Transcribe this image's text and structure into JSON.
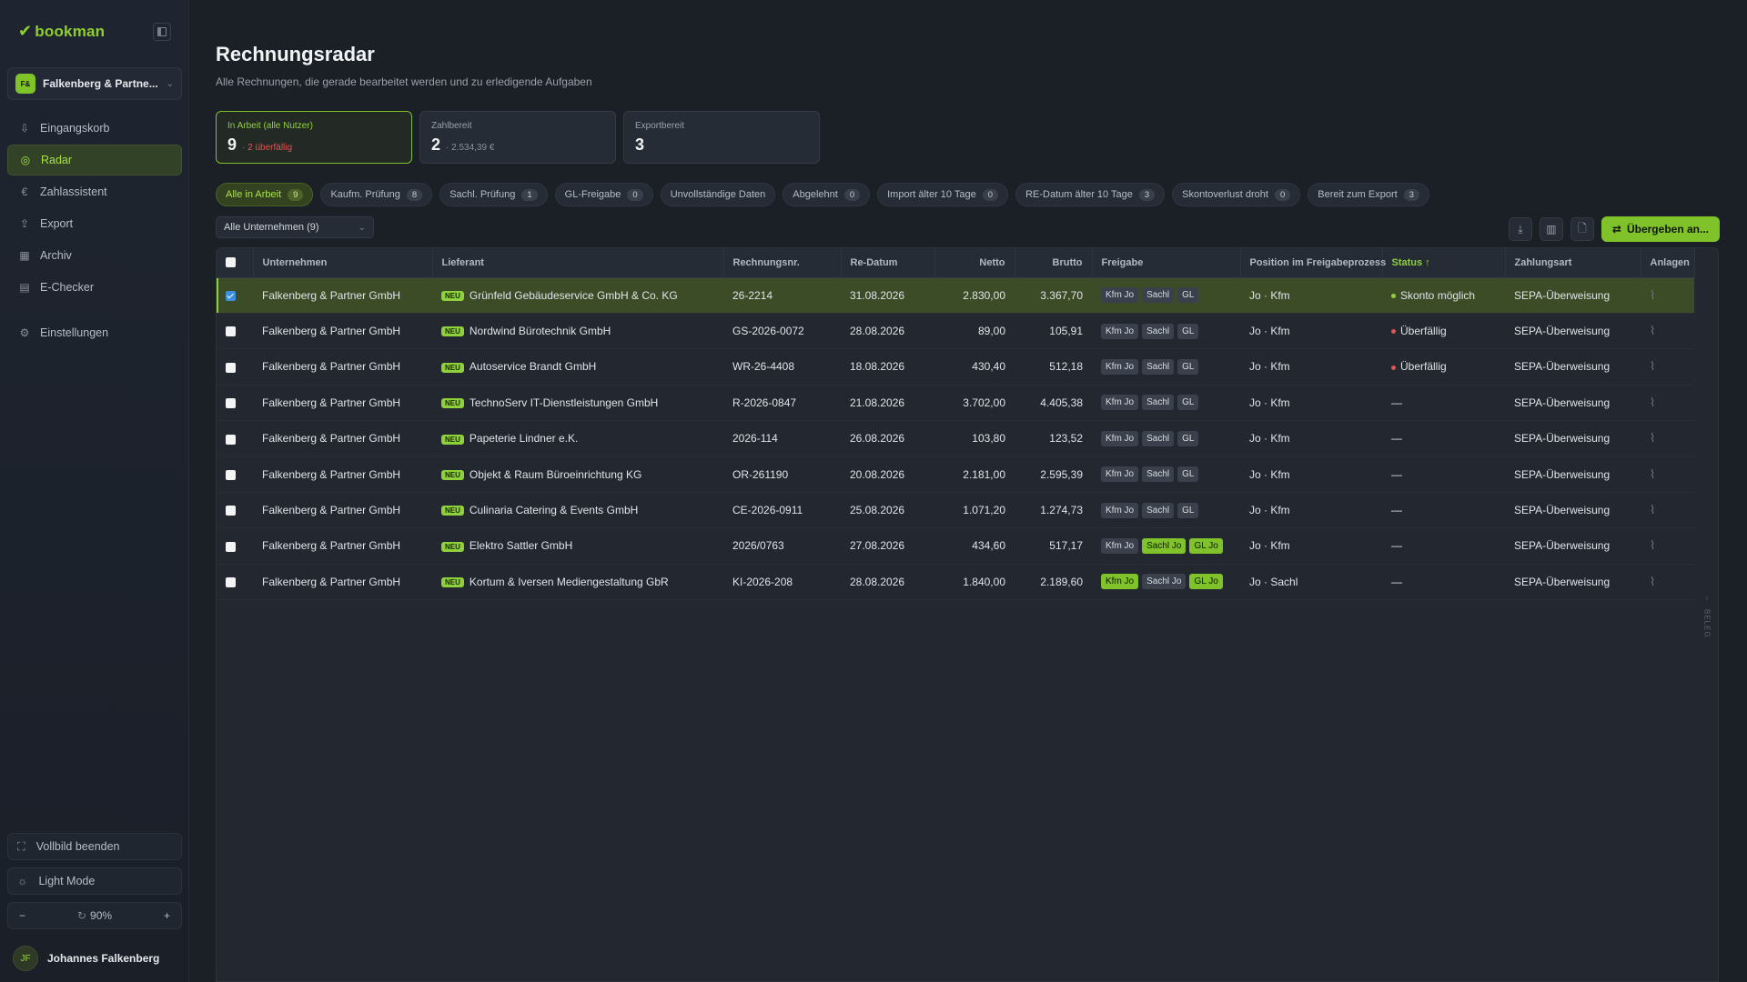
{
  "brand": {
    "name": "bookman"
  },
  "company": {
    "badge": "F&",
    "name": "Falkenberg & Partne..."
  },
  "nav": [
    {
      "label": "Eingangskorb",
      "icon": "inbox-icon",
      "glyph": "⇩"
    },
    {
      "label": "Radar",
      "icon": "radar-icon",
      "glyph": "◎"
    },
    {
      "label": "Zahlassistent",
      "icon": "euro-icon",
      "glyph": "€"
    },
    {
      "label": "Export",
      "icon": "export-icon",
      "glyph": "⇪"
    },
    {
      "label": "Archiv",
      "icon": "archive-icon",
      "glyph": "▦"
    },
    {
      "label": "E-Checker",
      "icon": "document-check-icon",
      "glyph": "▤"
    },
    {
      "label": "Einstellungen",
      "icon": "gear-icon",
      "glyph": "⚙"
    }
  ],
  "sidebar_bottom": {
    "fullscreen": "Vollbild beenden",
    "light_mode": "Light Mode",
    "zoom": "90%",
    "zoom_minus": "−",
    "zoom_plus": "+"
  },
  "user": {
    "initials": "JF",
    "name": "Johannes Falkenberg"
  },
  "page": {
    "title": "Rechnungsradar",
    "subtitle": "Alle Rechnungen, die gerade bearbeitet werden und zu erledigende Aufgaben"
  },
  "cards": [
    {
      "label": "In Arbeit (alle Nutzer)",
      "value": "9",
      "sub": "· 2 überfällig"
    },
    {
      "label": "Zahlbereit",
      "value": "2",
      "sub": "· 2.534,39 €"
    },
    {
      "label": "Exportbereit",
      "value": "3",
      "sub": ""
    }
  ],
  "filters": [
    {
      "label": "Alle in Arbeit",
      "count": "9"
    },
    {
      "label": "Kaufm. Prüfung",
      "count": "8"
    },
    {
      "label": "Sachl. Prüfung",
      "count": "1"
    },
    {
      "label": "GL-Freigabe",
      "count": "0"
    },
    {
      "label": "Unvollständige Daten",
      "count": ""
    },
    {
      "label": "Abgelehnt",
      "count": "0"
    },
    {
      "label": "Import älter 10 Tage",
      "count": "0"
    },
    {
      "label": "RE-Datum älter 10 Tage",
      "count": "3"
    },
    {
      "label": "Skontoverlust droht",
      "count": "0"
    },
    {
      "label": "Bereit zum Export",
      "count": "3"
    }
  ],
  "company_filter": "Alle Unternehmen (9)",
  "handover_button": "Übergeben an...",
  "columns": [
    "Unternehmen",
    "Lieferant",
    "Rechnungsnr.",
    "Re-Datum",
    "Netto",
    "Brutto",
    "Freigabe",
    "Position im Freigabeprozess",
    "Status ↑",
    "Zahlungsart",
    "Anlagen"
  ],
  "new_badge": "NEU",
  "side_panel_label": "BELEG",
  "rows": [
    {
      "company": "Falkenberg & Partner GmbH",
      "supplier": "Grünfeld Gebäudeservice GmbH & Co. KG",
      "number": "26-2214",
      "date": "31.08.2026",
      "net": "2.830,00",
      "gross": "3.367,70",
      "approvals": [
        "Kfm Jo",
        "Sachl",
        "GL"
      ],
      "approvals_done": [
        false,
        false,
        false
      ],
      "position": "Jo · Kfm",
      "status": "Skonto möglich",
      "status_color": "green",
      "payment": "SEPA-Überweisung",
      "selected": true
    },
    {
      "company": "Falkenberg & Partner GmbH",
      "supplier": "Nordwind Bürotechnik GmbH",
      "number": "GS-2026-0072",
      "date": "28.08.2026",
      "net": "89,00",
      "gross": "105,91",
      "approvals": [
        "Kfm Jo",
        "Sachl",
        "GL"
      ],
      "approvals_done": [
        false,
        false,
        false
      ],
      "position": "Jo · Kfm",
      "status": "Überfällig",
      "status_color": "red",
      "payment": "SEPA-Überweisung",
      "selected": false
    },
    {
      "company": "Falkenberg & Partner GmbH",
      "supplier": "Autoservice Brandt GmbH",
      "number": "WR-26-4408",
      "date": "18.08.2026",
      "net": "430,40",
      "gross": "512,18",
      "approvals": [
        "Kfm Jo",
        "Sachl",
        "GL"
      ],
      "approvals_done": [
        false,
        false,
        false
      ],
      "position": "Jo · Kfm",
      "status": "Überfällig",
      "status_color": "red",
      "payment": "SEPA-Überweisung",
      "selected": false
    },
    {
      "company": "Falkenberg & Partner GmbH",
      "supplier": "TechnoServ IT-Dienstleistungen GmbH",
      "number": "R-2026-0847",
      "date": "21.08.2026",
      "net": "3.702,00",
      "gross": "4.405,38",
      "approvals": [
        "Kfm Jo",
        "Sachl",
        "GL"
      ],
      "approvals_done": [
        false,
        false,
        false
      ],
      "position": "Jo · Kfm",
      "status": "—",
      "status_color": "",
      "payment": "SEPA-Überweisung",
      "selected": false
    },
    {
      "company": "Falkenberg & Partner GmbH",
      "supplier": "Papeterie Lindner e.K.",
      "number": "2026-114",
      "date": "26.08.2026",
      "net": "103,80",
      "gross": "123,52",
      "approvals": [
        "Kfm Jo",
        "Sachl",
        "GL"
      ],
      "approvals_done": [
        false,
        false,
        false
      ],
      "position": "Jo · Kfm",
      "status": "—",
      "status_color": "",
      "payment": "SEPA-Überweisung",
      "selected": false
    },
    {
      "company": "Falkenberg & Partner GmbH",
      "supplier": "Objekt & Raum Büroeinrichtung KG",
      "number": "OR-261190",
      "date": "20.08.2026",
      "net": "2.181,00",
      "gross": "2.595,39",
      "approvals": [
        "Kfm Jo",
        "Sachl",
        "GL"
      ],
      "approvals_done": [
        false,
        false,
        false
      ],
      "position": "Jo · Kfm",
      "status": "—",
      "status_color": "",
      "payment": "SEPA-Überweisung",
      "selected": false
    },
    {
      "company": "Falkenberg & Partner GmbH",
      "supplier": "Culinaria Catering & Events GmbH",
      "number": "CE-2026-0911",
      "date": "25.08.2026",
      "net": "1.071,20",
      "gross": "1.274,73",
      "approvals": [
        "Kfm Jo",
        "Sachl",
        "GL"
      ],
      "approvals_done": [
        false,
        false,
        false
      ],
      "position": "Jo · Kfm",
      "status": "—",
      "status_color": "",
      "payment": "SEPA-Überweisung",
      "selected": false
    },
    {
      "company": "Falkenberg & Partner GmbH",
      "supplier": "Elektro Sattler GmbH",
      "number": "2026/0763",
      "date": "27.08.2026",
      "net": "434,60",
      "gross": "517,17",
      "approvals": [
        "Kfm Jo",
        "Sachl Jo",
        "GL Jo"
      ],
      "approvals_done": [
        false,
        true,
        true
      ],
      "position": "Jo · Kfm",
      "status": "—",
      "status_color": "",
      "payment": "SEPA-Überweisung",
      "selected": false
    },
    {
      "company": "Falkenberg & Partner GmbH",
      "supplier": "Kortum & Iversen Mediengestaltung GbR",
      "number": "KI-2026-208",
      "date": "28.08.2026",
      "net": "1.840,00",
      "gross": "2.189,60",
      "approvals": [
        "Kfm Jo",
        "Sachl Jo",
        "GL Jo"
      ],
      "approvals_done": [
        true,
        false,
        true
      ],
      "position": "Jo · Sachl",
      "status": "—",
      "status_color": "",
      "payment": "SEPA-Überweisung",
      "selected": false
    }
  ]
}
